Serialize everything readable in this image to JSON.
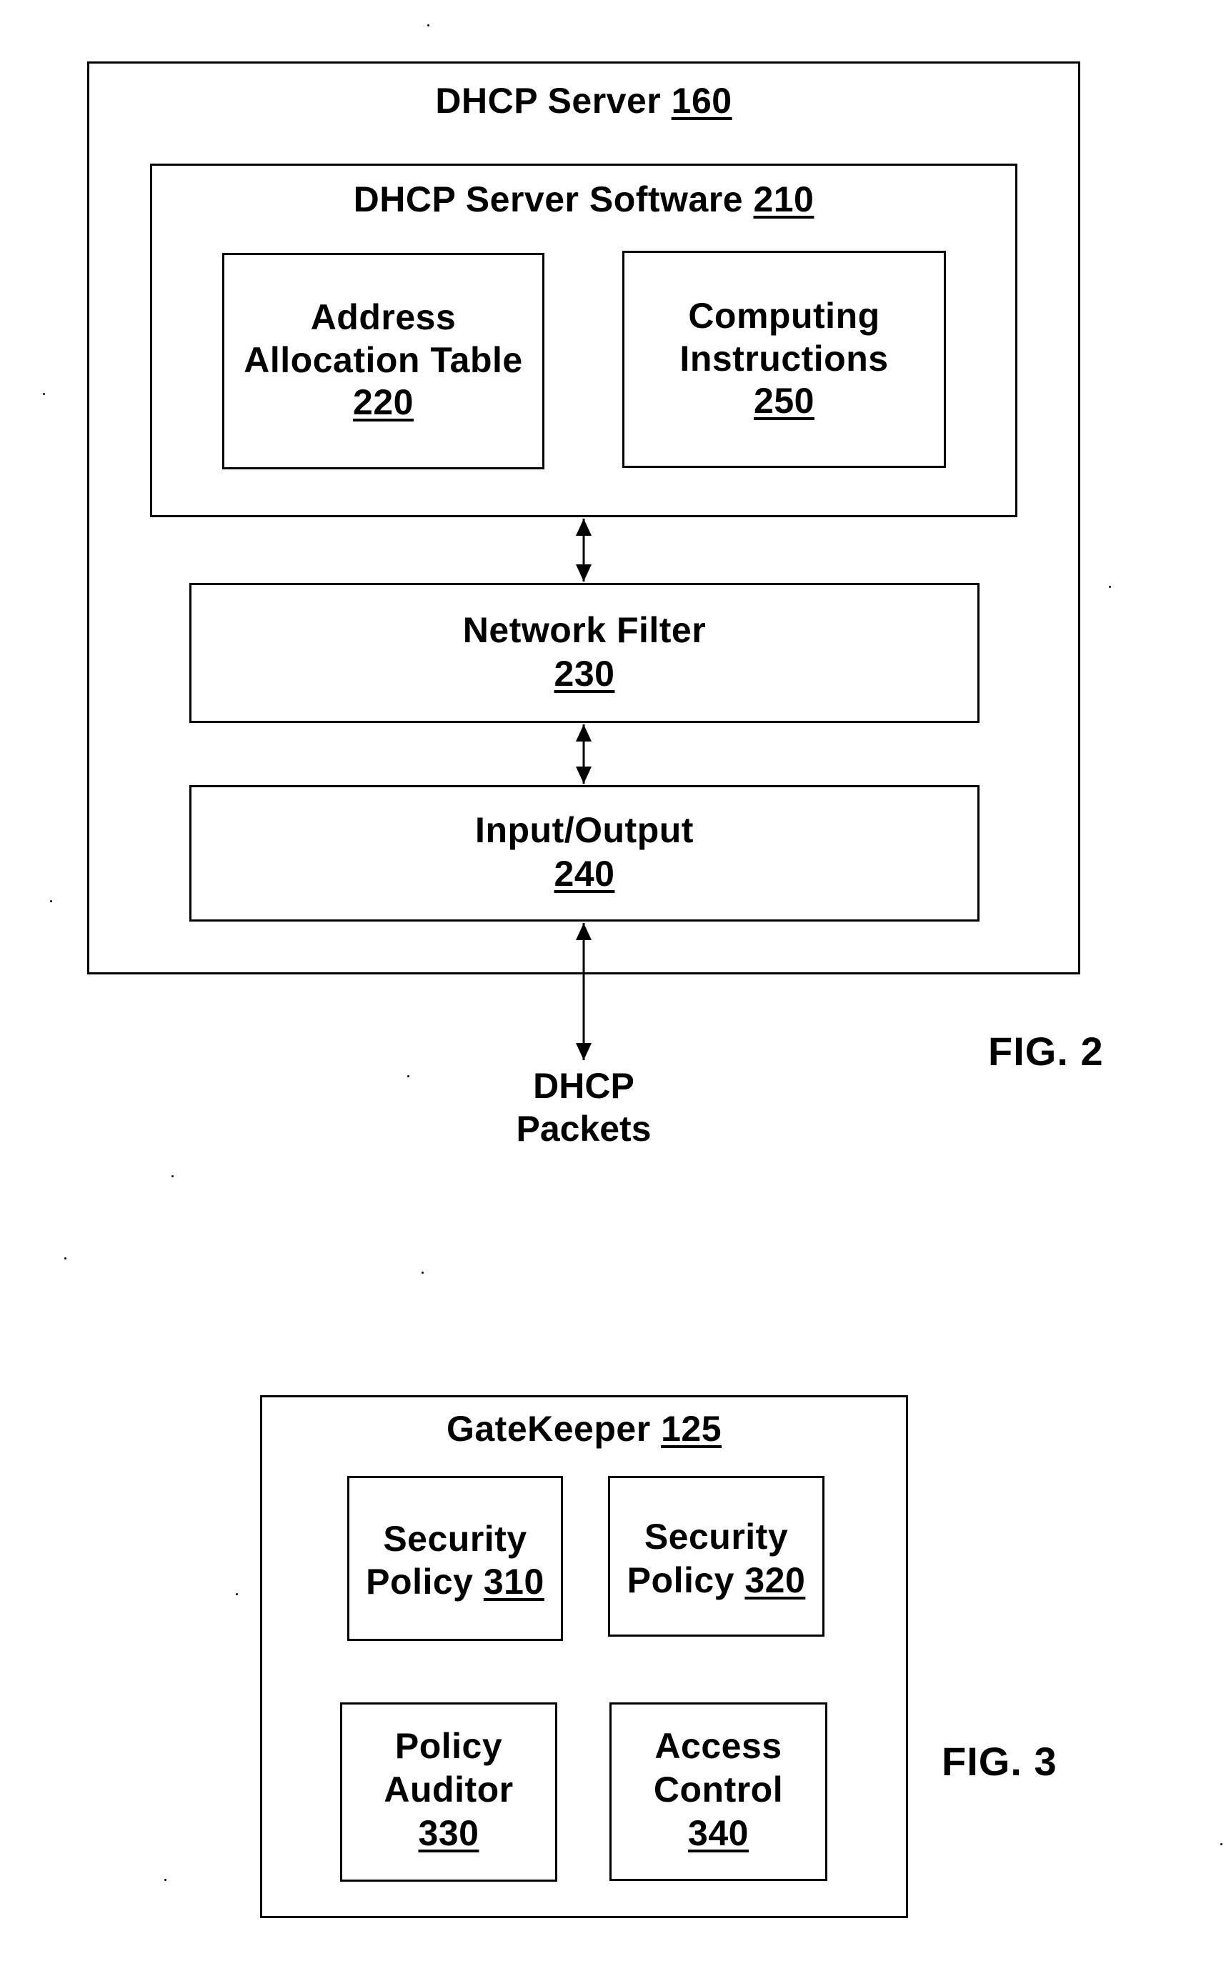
{
  "fig2": {
    "caption": "FIG. 2",
    "server": {
      "name": "DHCP Server",
      "ref": "160"
    },
    "software": {
      "name": "DHCP Server Software",
      "ref": "210"
    },
    "address_table": {
      "line1": "Address",
      "line2": "Allocation Table",
      "ref": "220"
    },
    "computing": {
      "line1": "Computing",
      "line2": "Instructions",
      "ref": "250"
    },
    "network_filter": {
      "name": "Network Filter",
      "ref": "230"
    },
    "io": {
      "name": "Input/Output",
      "ref": "240"
    },
    "packets": {
      "line1": "DHCP",
      "line2": "Packets"
    },
    "connections": [
      {
        "from": "DHCP Server Software 210",
        "to": "Network Filter 230",
        "type": "bidirectional"
      },
      {
        "from": "Network Filter 230",
        "to": "Input/Output 240",
        "type": "bidirectional"
      },
      {
        "from": "Input/Output 240",
        "to": "DHCP Packets",
        "type": "bidirectional"
      }
    ]
  },
  "fig3": {
    "caption": "FIG. 3",
    "gatekeeper": {
      "name": "GateKeeper",
      "ref": "125"
    },
    "security_policy_1": {
      "line1": "Security",
      "line2": "Policy",
      "ref": "310"
    },
    "security_policy_2": {
      "line1": "Security",
      "line2": "Policy",
      "ref": "320"
    },
    "policy_auditor": {
      "line1": "Policy",
      "line2": "Auditor",
      "ref": "330"
    },
    "access_control": {
      "line1": "Access",
      "line2": "Control",
      "ref": "340"
    }
  }
}
